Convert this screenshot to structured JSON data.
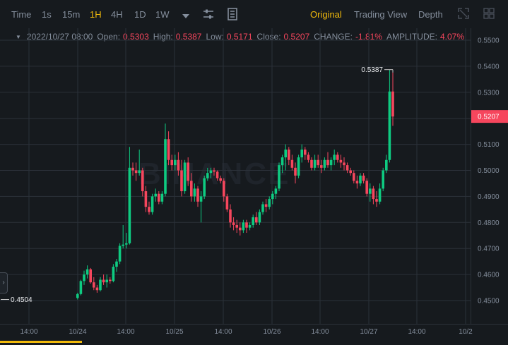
{
  "toolbar": {
    "time_label": "Time",
    "intervals": [
      "1s",
      "15m",
      "1H",
      "4H",
      "1D",
      "1W"
    ],
    "active_interval": "1H",
    "views": [
      "Original",
      "Trading View",
      "Depth"
    ],
    "active_view": "Original"
  },
  "ohlc": {
    "datetime": "2022/10/27 08:00",
    "open_label": "Open:",
    "open": "0.5303",
    "high_label": "High:",
    "high": "0.5387",
    "low_label": "Low:",
    "low": "0.5171",
    "close_label": "Close:",
    "close": "0.5207",
    "change_label": "CHANGE:",
    "change": "-1.81%",
    "amplitude_label": "AMPLITUDE:",
    "amplitude": "4.07%"
  },
  "watermark": "BINANCE",
  "colors": {
    "up": "#0ecb81",
    "down": "#f6465d",
    "accent": "#f0b90b",
    "background": "#161a1e",
    "grid": "#2b3139"
  },
  "chart_data": {
    "type": "candlestick",
    "y_ticks": [
      "0.4500",
      "0.4600",
      "0.4700",
      "0.4800",
      "0.4900",
      "0.5000",
      "0.5100",
      "0.5200",
      "0.5300",
      "0.5400",
      "0.5500"
    ],
    "ylim": [
      0.443,
      0.552
    ],
    "x_ticks": [
      "14:00",
      "10/24",
      "14:00",
      "10/25",
      "14:00",
      "10/26",
      "14:00",
      "10/27",
      "14:00",
      "10/2"
    ],
    "last_price_label": "0.5207",
    "max_label": "0.5387",
    "min_label": "0.4504",
    "series": [
      {
        "name": "candles",
        "values": [
          [
            0.451,
            0.453,
            0.4504,
            0.4525
          ],
          [
            0.4525,
            0.458,
            0.452,
            0.4575
          ],
          [
            0.4575,
            0.4615,
            0.456,
            0.46
          ],
          [
            0.46,
            0.4635,
            0.4585,
            0.462
          ],
          [
            0.462,
            0.4625,
            0.4565,
            0.457
          ],
          [
            0.457,
            0.459,
            0.454,
            0.455
          ],
          [
            0.455,
            0.456,
            0.453,
            0.454
          ],
          [
            0.454,
            0.459,
            0.4535,
            0.458
          ],
          [
            0.458,
            0.46,
            0.456,
            0.457
          ],
          [
            0.457,
            0.46,
            0.455,
            0.458
          ],
          [
            0.458,
            0.459,
            0.4565,
            0.4575
          ],
          [
            0.4575,
            0.464,
            0.457,
            0.463
          ],
          [
            0.463,
            0.466,
            0.461,
            0.465
          ],
          [
            0.465,
            0.472,
            0.464,
            0.471
          ],
          [
            0.471,
            0.479,
            0.47,
            0.4715
          ],
          [
            0.4715,
            0.476,
            0.47,
            0.472
          ],
          [
            0.472,
            0.509,
            0.4715,
            0.501
          ],
          [
            0.501,
            0.503,
            0.498,
            0.5
          ],
          [
            0.5,
            0.503,
            0.496,
            0.499
          ],
          [
            0.499,
            0.508,
            0.498,
            0.5
          ],
          [
            0.5,
            0.501,
            0.49,
            0.492
          ],
          [
            0.492,
            0.494,
            0.484,
            0.486
          ],
          [
            0.486,
            0.488,
            0.483,
            0.484
          ],
          [
            0.484,
            0.491,
            0.483,
            0.49
          ],
          [
            0.49,
            0.493,
            0.488,
            0.491
          ],
          [
            0.491,
            0.492,
            0.487,
            0.488
          ],
          [
            0.488,
            0.492,
            0.487,
            0.491
          ],
          [
            0.491,
            0.518,
            0.49,
            0.512
          ],
          [
            0.512,
            0.515,
            0.502,
            0.504
          ],
          [
            0.504,
            0.506,
            0.5,
            0.502
          ],
          [
            0.502,
            0.506,
            0.5,
            0.504
          ],
          [
            0.504,
            0.507,
            0.498,
            0.5
          ],
          [
            0.5,
            0.504,
            0.49,
            0.492
          ],
          [
            0.492,
            0.504,
            0.491,
            0.503
          ],
          [
            0.503,
            0.505,
            0.494,
            0.496
          ],
          [
            0.496,
            0.499,
            0.488,
            0.49
          ],
          [
            0.49,
            0.495,
            0.488,
            0.493
          ],
          [
            0.493,
            0.494,
            0.486,
            0.488
          ],
          [
            0.488,
            0.492,
            0.48,
            0.49
          ],
          [
            0.49,
            0.498,
            0.489,
            0.497
          ],
          [
            0.497,
            0.501,
            0.496,
            0.499
          ],
          [
            0.499,
            0.501,
            0.497,
            0.5
          ],
          [
            0.5,
            0.501,
            0.498,
            0.4995
          ],
          [
            0.4995,
            0.5,
            0.496,
            0.497
          ],
          [
            0.497,
            0.498,
            0.495,
            0.496
          ],
          [
            0.496,
            0.497,
            0.488,
            0.49
          ],
          [
            0.49,
            0.491,
            0.484,
            0.485
          ],
          [
            0.485,
            0.487,
            0.478,
            0.48
          ],
          [
            0.48,
            0.482,
            0.477,
            0.479
          ],
          [
            0.479,
            0.481,
            0.476,
            0.478
          ],
          [
            0.478,
            0.48,
            0.475,
            0.477
          ],
          [
            0.477,
            0.481,
            0.476,
            0.48
          ],
          [
            0.48,
            0.481,
            0.476,
            0.478
          ],
          [
            0.478,
            0.48,
            0.477,
            0.479
          ],
          [
            0.479,
            0.483,
            0.478,
            0.482
          ],
          [
            0.482,
            0.484,
            0.479,
            0.48
          ],
          [
            0.48,
            0.485,
            0.479,
            0.484
          ],
          [
            0.484,
            0.488,
            0.483,
            0.487
          ],
          [
            0.487,
            0.489,
            0.484,
            0.486
          ],
          [
            0.486,
            0.49,
            0.485,
            0.489
          ],
          [
            0.489,
            0.492,
            0.487,
            0.491
          ],
          [
            0.491,
            0.494,
            0.489,
            0.493
          ],
          [
            0.493,
            0.503,
            0.492,
            0.502
          ],
          [
            0.502,
            0.506,
            0.499,
            0.505
          ],
          [
            0.505,
            0.51,
            0.5,
            0.508
          ],
          [
            0.508,
            0.509,
            0.502,
            0.504
          ],
          [
            0.504,
            0.506,
            0.5,
            0.501
          ],
          [
            0.501,
            0.503,
            0.495,
            0.498
          ],
          [
            0.498,
            0.506,
            0.497,
            0.505
          ],
          [
            0.505,
            0.51,
            0.503,
            0.508
          ],
          [
            0.508,
            0.509,
            0.504,
            0.506
          ],
          [
            0.506,
            0.507,
            0.503,
            0.504
          ],
          [
            0.504,
            0.505,
            0.5,
            0.501
          ],
          [
            0.501,
            0.506,
            0.5,
            0.504
          ],
          [
            0.504,
            0.506,
            0.501,
            0.502
          ],
          [
            0.502,
            0.504,
            0.499,
            0.501
          ],
          [
            0.501,
            0.505,
            0.5,
            0.504
          ],
          [
            0.504,
            0.507,
            0.501,
            0.502
          ],
          [
            0.502,
            0.505,
            0.5,
            0.504
          ],
          [
            0.504,
            0.508,
            0.502,
            0.506
          ],
          [
            0.506,
            0.507,
            0.503,
            0.504
          ],
          [
            0.504,
            0.506,
            0.501,
            0.503
          ],
          [
            0.503,
            0.505,
            0.5,
            0.502
          ],
          [
            0.502,
            0.503,
            0.499,
            0.5
          ],
          [
            0.5,
            0.501,
            0.498,
            0.499
          ],
          [
            0.499,
            0.5,
            0.495,
            0.496
          ],
          [
            0.496,
            0.498,
            0.493,
            0.495
          ],
          [
            0.495,
            0.499,
            0.494,
            0.498
          ],
          [
            0.498,
            0.499,
            0.495,
            0.496
          ],
          [
            0.496,
            0.497,
            0.49,
            0.491
          ],
          [
            0.491,
            0.495,
            0.488,
            0.493
          ],
          [
            0.493,
            0.494,
            0.487,
            0.489
          ],
          [
            0.489,
            0.492,
            0.486,
            0.488
          ],
          [
            0.488,
            0.495,
            0.487,
            0.493
          ],
          [
            0.493,
            0.501,
            0.492,
            0.5
          ],
          [
            0.5,
            0.506,
            0.499,
            0.504
          ],
          [
            0.504,
            0.5387,
            0.503,
            0.5303
          ],
          [
            0.5303,
            0.5387,
            0.5171,
            0.5207
          ]
        ]
      }
    ]
  }
}
